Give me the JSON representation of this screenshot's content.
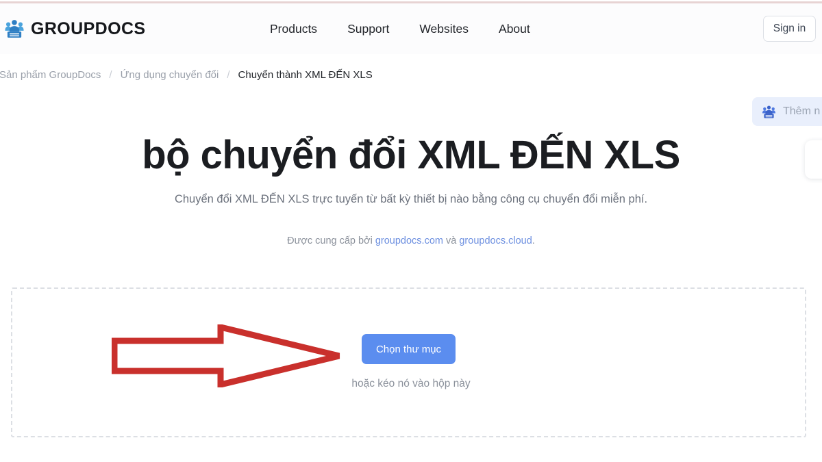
{
  "header": {
    "brand": {
      "icon": "groupdocs-people-logo-icon",
      "text": "GROUPDOCS"
    },
    "nav": [
      {
        "label": "Products"
      },
      {
        "label": "Support"
      },
      {
        "label": "Websites"
      },
      {
        "label": "About"
      }
    ],
    "signin_label": "Sign in"
  },
  "breadcrumb": {
    "items": [
      {
        "label": "Sản phẩm GroupDocs"
      },
      {
        "label": "Ứng dụng chuyển đổi"
      },
      {
        "label": "Chuyển thành XML ĐẾN XLS"
      }
    ],
    "separator": "/"
  },
  "widgets": {
    "add_pill": {
      "icon": "people-group-icon",
      "label": "Thêm n"
    }
  },
  "hero": {
    "title": "bộ chuyển đổi XML ĐẾN XLS",
    "subtitle": "Chuyển đổi XML ĐẾN XLS trực tuyến từ bất kỳ thiết bị nào bằng công cụ chuyển đổi miễn phí.",
    "powered_prefix": "Được cung cấp bởi ",
    "powered_link1": "groupdocs.com",
    "powered_conj": " và ",
    "powered_link2": "groupdocs.cloud",
    "powered_suffix": "."
  },
  "dropzone": {
    "choose_label": "Chọn thư mục",
    "drag_hint": "hoặc kéo nó vào hộp này"
  },
  "annotation": {
    "arrow": "red-right-arrow-annotation"
  },
  "colors": {
    "accent_blue": "#5b8def",
    "link_blue": "#6c8fe0",
    "pill_bg": "#e9effc",
    "annotation_red": "#c9302c",
    "dash_border": "#dcdfe4",
    "top_rule": "#e7d3d3"
  }
}
